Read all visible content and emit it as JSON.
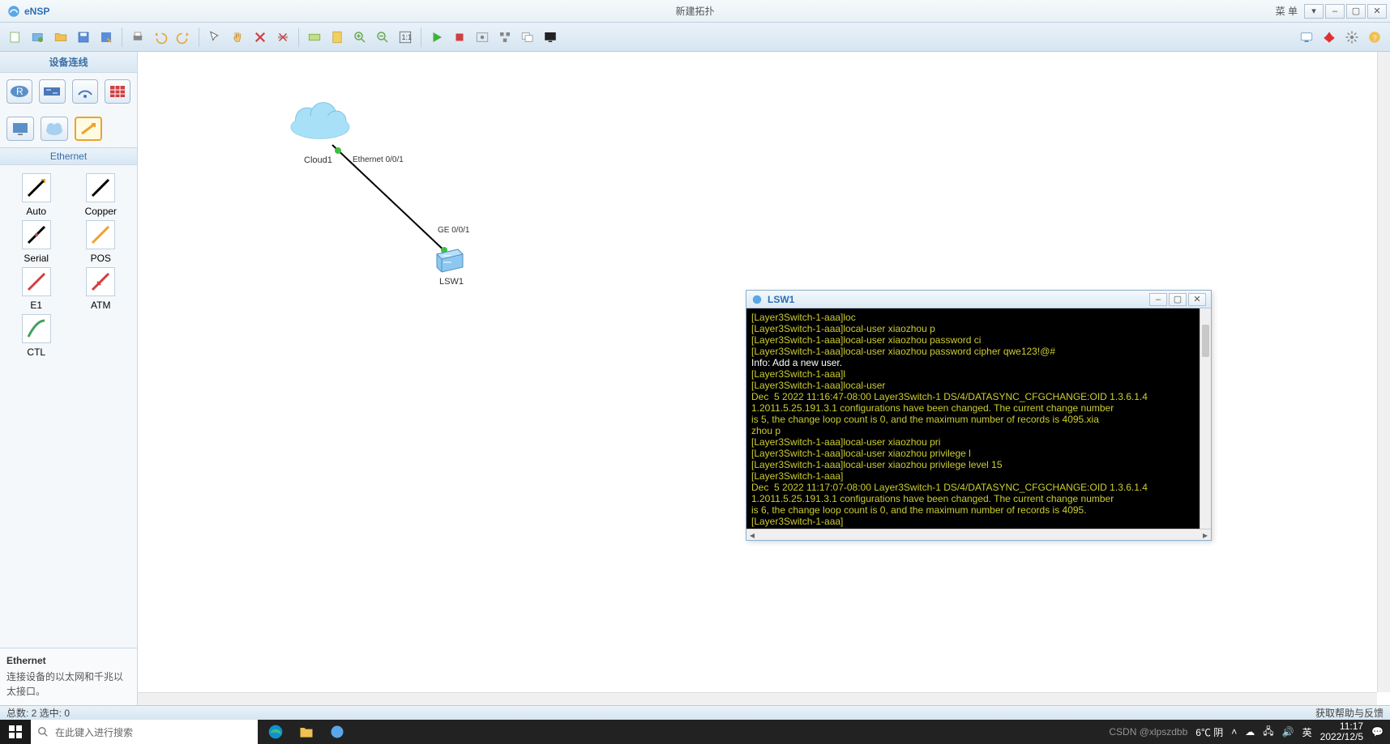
{
  "app": {
    "name": "eNSP",
    "title": "新建拓扑"
  },
  "menu_label": "菜 单",
  "window_buttons": {
    "min": "–",
    "max": "▢",
    "close": "✕",
    "dropdown": "▾"
  },
  "sidebar": {
    "header": "设备连线",
    "category": "Ethernet",
    "connectors": [
      {
        "name": "Auto"
      },
      {
        "name": "Copper"
      },
      {
        "name": "Serial"
      },
      {
        "name": "POS"
      },
      {
        "name": "E1"
      },
      {
        "name": "ATM"
      },
      {
        "name": "CTL"
      }
    ],
    "desc_title": "Ethernet",
    "desc_body": "连接设备的以太网和千兆以太接口。"
  },
  "topology": {
    "cloud_label": "Cloud1",
    "cloud_port": "Ethernet 0/0/1",
    "switch_label": "LSW1",
    "switch_port": "GE 0/0/1"
  },
  "terminal": {
    "title": "LSW1",
    "lines": [
      "[Layer3Switch-1-aaa]loc",
      "[Layer3Switch-1-aaa]local-user xiaozhou p",
      "[Layer3Switch-1-aaa]local-user xiaozhou password ci",
      "[Layer3Switch-1-aaa]local-user xiaozhou password cipher qwe123!@#",
      "Info: Add a new user.",
      "[Layer3Switch-1-aaa]l",
      "[Layer3Switch-1-aaa]local-user",
      "Dec  5 2022 11:16:47-08:00 Layer3Switch-1 DS/4/DATASYNC_CFGCHANGE:OID 1.3.6.1.4",
      "1.2011.5.25.191.3.1 configurations have been changed. The current change number",
      "is 5, the change loop count is 0, and the maximum number of records is 4095.xia",
      "zhou p",
      "[Layer3Switch-1-aaa]local-user xiaozhou pri",
      "[Layer3Switch-1-aaa]local-user xiaozhou privilege l",
      "[Layer3Switch-1-aaa]local-user xiaozhou privilege level 15",
      "[Layer3Switch-1-aaa]",
      "Dec  5 2022 11:17:07-08:00 Layer3Switch-1 DS/4/DATASYNC_CFGCHANGE:OID 1.3.6.1.4",
      "1.2011.5.25.191.3.1 configurations have been changed. The current change number",
      "is 6, the change loop count is 0, and the maximum number of records is 4095.",
      "[Layer3Switch-1-aaa]"
    ]
  },
  "status": {
    "left": "总数: 2 选中: 0",
    "right": "获取帮助与反馈"
  },
  "taskbar": {
    "search_placeholder": "在此键入进行搜索",
    "weather": "6℃ 阴",
    "ime": "英",
    "time": "11:17",
    "date": "2022/12/5",
    "watermark": "CSDN @xlpszdbb"
  },
  "colors": {
    "accent": "#2a6fb5",
    "term_fg": "#cccc33"
  }
}
